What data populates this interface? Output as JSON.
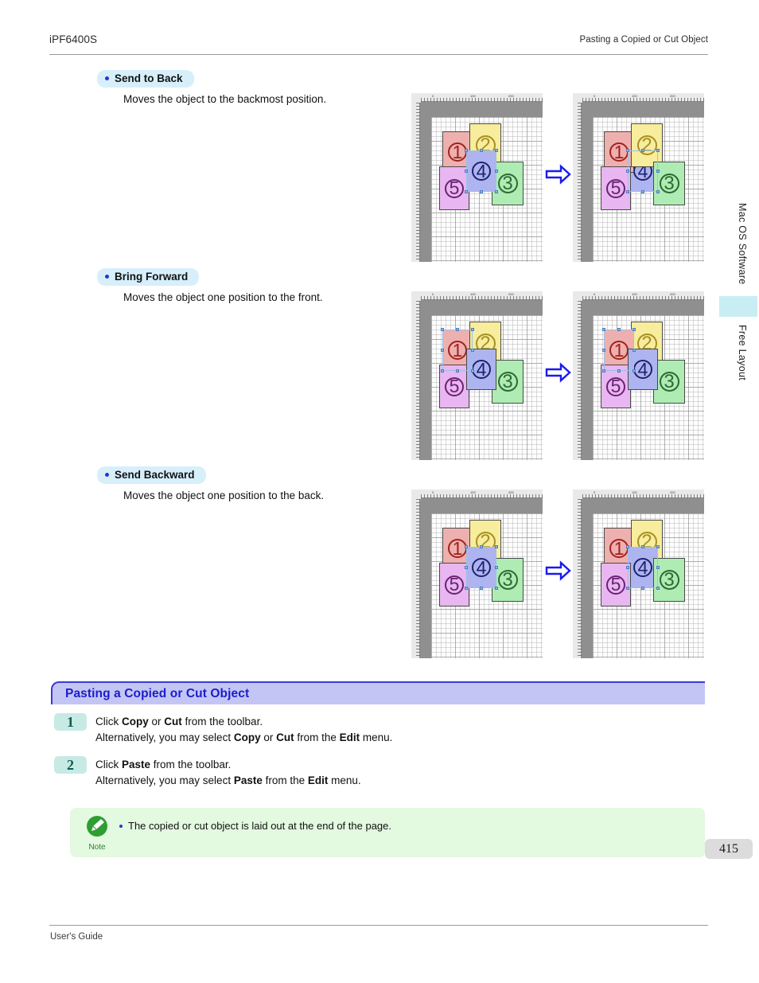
{
  "header": {
    "product": "iPF6400S",
    "section": "Pasting a Copied or Cut Object"
  },
  "bullets": [
    {
      "label": "Send to Back",
      "description": "Moves the object to the backmost position."
    },
    {
      "label": "Bring Forward",
      "description": "Moves the object one position to the front."
    },
    {
      "label": "Send Backward",
      "description": "Moves the object one position to the back."
    }
  ],
  "illustrations": {
    "arrow_glyph": "⇒",
    "cards": [
      {
        "id": "1",
        "fill": "#eeb0ae",
        "ink": "#a0221f"
      },
      {
        "id": "2",
        "fill": "#f8ec9d",
        "ink": "#a89122"
      },
      {
        "id": "3",
        "fill": "#aeecb4",
        "ink": "#2e6b32"
      },
      {
        "id": "4",
        "fill": "#aeb4ef",
        "ink": "#1d2270"
      },
      {
        "id": "5",
        "fill": "#e8b6f0",
        "ink": "#6b2173"
      }
    ],
    "ruler_marks": [
      "0",
      "100",
      "200"
    ],
    "rows": [
      {
        "name": "send-to-back",
        "before_order": [
          "1",
          "2",
          "3",
          "5",
          "4"
        ],
        "after_order": [
          "4",
          "1",
          "2",
          "3",
          "5"
        ],
        "selected": "4"
      },
      {
        "name": "bring-forward",
        "before_order": [
          "1",
          "2",
          "3",
          "5",
          "4"
        ],
        "after_order": [
          "2",
          "3",
          "1",
          "5",
          "4"
        ],
        "selected": "1"
      },
      {
        "name": "send-backward",
        "before_order": [
          "1",
          "2",
          "3",
          "5",
          "4"
        ],
        "after_order": [
          "1",
          "2",
          "4",
          "5",
          "3"
        ],
        "selected": "4"
      }
    ]
  },
  "section_heading": "Pasting a Copied or Cut Object",
  "steps": [
    {
      "number": "1",
      "line1": [
        {
          "t": "Click ",
          "b": false
        },
        {
          "t": "Copy",
          "b": true
        },
        {
          "t": " or ",
          "b": false
        },
        {
          "t": "Cut",
          "b": true
        },
        {
          "t": " from the toolbar.",
          "b": false
        }
      ],
      "line2": [
        {
          "t": "Alternatively, you may select ",
          "b": false
        },
        {
          "t": "Copy",
          "b": true
        },
        {
          "t": " or ",
          "b": false
        },
        {
          "t": "Cut",
          "b": true
        },
        {
          "t": " from the ",
          "b": false
        },
        {
          "t": "Edit",
          "b": true
        },
        {
          "t": " menu.",
          "b": false
        }
      ]
    },
    {
      "number": "2",
      "line1": [
        {
          "t": "Click ",
          "b": false
        },
        {
          "t": "Paste",
          "b": true
        },
        {
          "t": " from the toolbar.",
          "b": false
        }
      ],
      "line2": [
        {
          "t": "Alternatively, you may select ",
          "b": false
        },
        {
          "t": "Paste",
          "b": true
        },
        {
          "t": " from the ",
          "b": false
        },
        {
          "t": "Edit",
          "b": true
        },
        {
          "t": " menu.",
          "b": false
        }
      ]
    }
  ],
  "note": {
    "label": "Note",
    "icon": "pencil-icon",
    "text": "The copied or cut object is laid out at the end of the page."
  },
  "side_tabs": [
    {
      "label": "Mac OS Software",
      "active": false
    },
    {
      "label": "Free Layout",
      "active": true
    }
  ],
  "page_number": "415",
  "footer": "User's Guide",
  "colors": {
    "pill_bg": "#d6effb",
    "bullet_blue": "#2b35c8",
    "section_bar_bg": "#c3c6f5",
    "section_bar_border": "#3b3bd0",
    "section_title": "#1c1ccc",
    "step_badge_bg": "#c7eae4",
    "step_badge_text": "#0d5c54",
    "note_bg": "#e3f9e0",
    "note_green": "#2e9e33",
    "tab_highlight": "#c8eef4",
    "page_num_bg": "#dcdcdc",
    "arrow": "#1a1aee"
  }
}
